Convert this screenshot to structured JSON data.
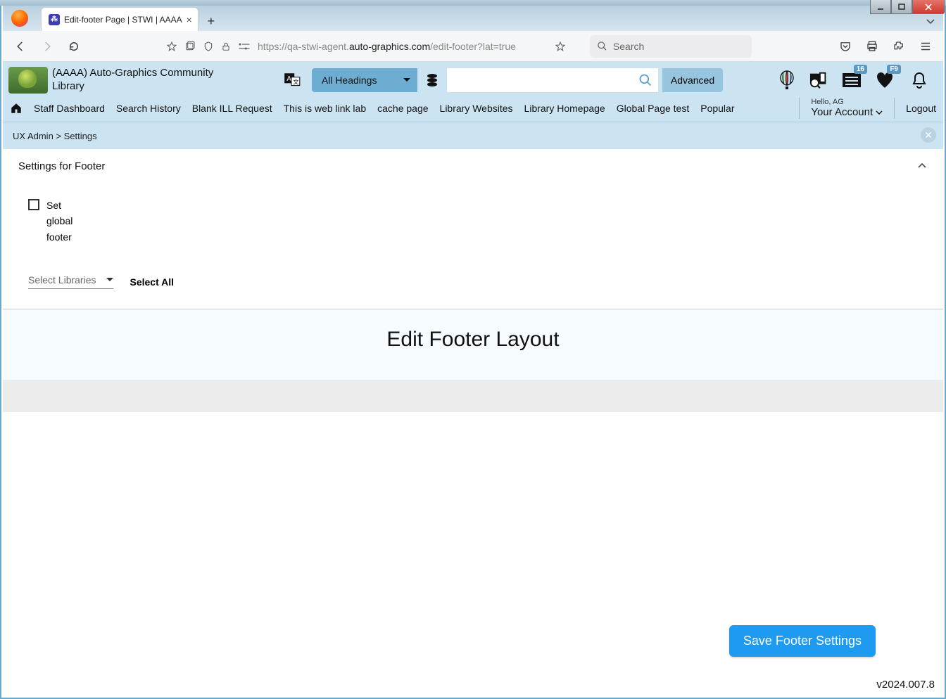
{
  "window": {
    "tab_title": "Edit-footer Page | STWI | AAAA"
  },
  "browser": {
    "url_prefix": "https://qa-stwi-agent.",
    "url_domain": "auto-graphics.com",
    "url_path": "/edit-footer?lat=true",
    "search_placeholder": "Search"
  },
  "header": {
    "brand_title": "(AAAA) Auto-Graphics Community Library",
    "headings_label": "All Headings",
    "advanced_label": "Advanced",
    "list_badge": "16",
    "heart_badge": "F9"
  },
  "nav": {
    "items": [
      "Staff Dashboard",
      "Search History",
      "Blank ILL Request",
      "This is web link lab",
      "cache page",
      "Library Websites",
      "Library Homepage",
      "Global Page test",
      "Popular"
    ],
    "hello_prefix": "Hello, AG",
    "account_label": "Your Account",
    "logout_label": "Logout"
  },
  "breadcrumb": {
    "root": "UX Admin",
    "sep": ">",
    "leaf": "Settings"
  },
  "settings": {
    "title": "Settings for Footer",
    "checkbox_label": "Set global footer",
    "select_libraries_label": "Select Libraries",
    "select_all_label": "Select All"
  },
  "editor": {
    "title": "Edit Footer Layout"
  },
  "actions": {
    "save_label": "Save Footer Settings"
  },
  "meta": {
    "version": "v2024.007.8"
  }
}
